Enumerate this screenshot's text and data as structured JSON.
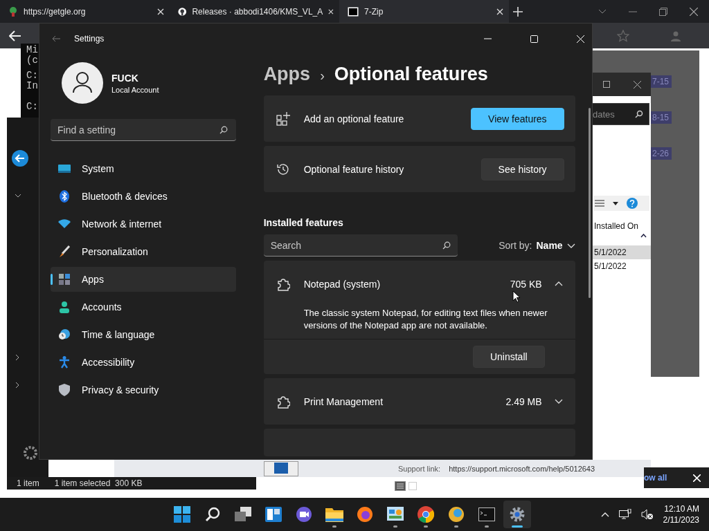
{
  "browser": {
    "tabs": [
      {
        "title": "https://getgle.org",
        "kind": "leaf",
        "selected": false
      },
      {
        "title": "Releases · abbodi1406/KMS_VL_A",
        "kind": "github",
        "selected": false
      },
      {
        "title": "7-Zip",
        "kind": "sevenzip",
        "selected": true
      }
    ]
  },
  "console": {
    "lines": [
      "Mi",
      "(c",
      "C:",
      "In",
      "C:"
    ]
  },
  "tags": [
    "7-15",
    "8-15",
    "2-26"
  ],
  "update_window": {
    "search_value": "dates",
    "column": "Installed On",
    "dates": [
      {
        "text": "5/1/2022",
        "selected": true
      },
      {
        "text": "5/1/2022",
        "selected": false
      }
    ],
    "support_label": "Support link:",
    "support_url": "https://support.microsoft.com/help/5012643"
  },
  "explorer_status": {
    "items": "1 item",
    "selected": "1 item selected  300 KB"
  },
  "notification": {
    "link": "ow all"
  },
  "settings": {
    "title": "Settings",
    "user": {
      "name": "FUCK",
      "account": "Local Account"
    },
    "search": {
      "placeholder": "Find a setting"
    },
    "nav": [
      {
        "label": "System",
        "kind": "system",
        "selected": false
      },
      {
        "label": "Bluetooth & devices",
        "kind": "bluetooth",
        "selected": false
      },
      {
        "label": "Network & internet",
        "kind": "network",
        "selected": false
      },
      {
        "label": "Personalization",
        "kind": "brush",
        "selected": false
      },
      {
        "label": "Apps",
        "kind": "apps",
        "selected": true
      },
      {
        "label": "Accounts",
        "kind": "person",
        "selected": false
      },
      {
        "label": "Time & language",
        "kind": "clock",
        "selected": false
      },
      {
        "label": "Accessibility",
        "kind": "accessibility",
        "selected": false
      },
      {
        "label": "Privacy & security",
        "kind": "shield",
        "selected": false
      }
    ],
    "breadcrumb": {
      "parent": "Apps",
      "separator": "›",
      "current": "Optional features"
    },
    "actions": [
      {
        "label": "Add an optional feature",
        "kind": "add",
        "button": "View features",
        "primary": true
      },
      {
        "label": "Optional feature history",
        "kind": "history",
        "button": "See history",
        "primary": false
      }
    ],
    "installed": {
      "heading": "Installed features",
      "search_placeholder": "Search",
      "sort_label": "Sort by:",
      "sort_value": "Name"
    },
    "features": [
      {
        "name": "Notepad (system)",
        "size": "705 KB",
        "expanded": true,
        "description": "The classic system Notepad, for editing text files when newer versions of the Notepad app are not available.",
        "action": "Uninstall"
      },
      {
        "name": "Print Management",
        "size": "2.49 MB",
        "expanded": false
      }
    ]
  },
  "taskbar": {
    "apps": [
      {
        "kind": "start",
        "running": false,
        "active": false
      },
      {
        "kind": "search",
        "running": false,
        "active": false
      },
      {
        "kind": "taskview",
        "running": false,
        "active": false
      },
      {
        "kind": "widgets",
        "running": false,
        "active": false
      },
      {
        "kind": "chat",
        "running": false,
        "active": false
      },
      {
        "kind": "folder",
        "running": true,
        "active": false
      },
      {
        "kind": "firefox",
        "running": false,
        "active": false
      },
      {
        "kind": "control",
        "running": true,
        "active": false
      },
      {
        "kind": "chrome",
        "running": true,
        "active": false
      },
      {
        "kind": "orb",
        "running": true,
        "active": false
      },
      {
        "kind": "terminal",
        "running": true,
        "active": false
      },
      {
        "kind": "gear",
        "running": true,
        "active": true
      }
    ],
    "time": "12:10 AM",
    "date": "2/11/2023"
  }
}
